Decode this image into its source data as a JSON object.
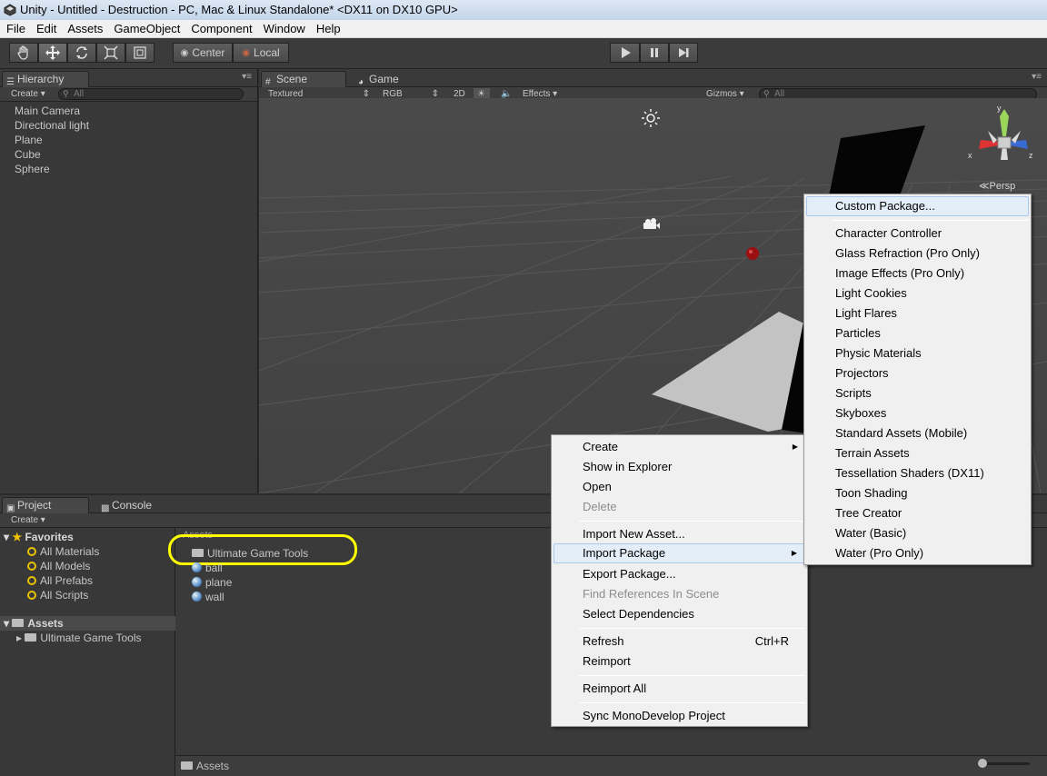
{
  "window": {
    "title": "Unity - Untitled - Destruction - PC, Mac & Linux Standalone* <DX11 on DX10 GPU>"
  },
  "menubar": [
    "File",
    "Edit",
    "Assets",
    "GameObject",
    "Component",
    "Window",
    "Help"
  ],
  "toolbar": {
    "pivot_label": "Center",
    "space_label": "Local"
  },
  "hierarchy": {
    "tab": "Hierarchy",
    "create": "Create",
    "search_placeholder": "All",
    "items": [
      "Main Camera",
      "Directional light",
      "Plane",
      "Cube",
      "Sphere"
    ]
  },
  "scene": {
    "tab_scene": "Scene",
    "tab_game": "Game",
    "shading": "Textured",
    "render_mode": "RGB",
    "mode_2d": "2D",
    "effects": "Effects",
    "gizmos": "Gizmos",
    "search_placeholder": "All",
    "axis_x": "x",
    "axis_y": "y",
    "axis_z": "z",
    "projection": "Persp"
  },
  "project": {
    "tab_project": "Project",
    "tab_console": "Console",
    "create": "Create",
    "favorites_label": "Favorites",
    "favorites": [
      "All Materials",
      "All Models",
      "All Prefabs",
      "All Scripts"
    ],
    "assets_label": "Assets",
    "tree_children": [
      "Ultimate Game Tools"
    ],
    "breadcrumb": "Assets",
    "files": [
      {
        "name": "Ultimate Game Tools",
        "kind": "folder"
      },
      {
        "name": "ball",
        "kind": "asset"
      },
      {
        "name": "plane",
        "kind": "asset"
      },
      {
        "name": "wall",
        "kind": "asset"
      }
    ],
    "footer_path": "Assets",
    "highlight_color": "#ffff00"
  },
  "context_menu": {
    "items": [
      {
        "label": "Create",
        "submenu": true
      },
      {
        "label": "Show in Explorer"
      },
      {
        "label": "Open"
      },
      {
        "label": "Delete",
        "disabled": true
      },
      {
        "label": "Import New Asset..."
      },
      {
        "label": "Import Package",
        "submenu": true,
        "highlighted": true
      },
      {
        "label": "Export Package..."
      },
      {
        "label": "Find References In Scene",
        "disabled": true
      },
      {
        "label": "Select Dependencies"
      },
      {
        "label": "Refresh",
        "shortcut": "Ctrl+R"
      },
      {
        "label": "Reimport"
      },
      {
        "label": "Reimport All"
      },
      {
        "label": "Sync MonoDevelop Project"
      }
    ]
  },
  "import_submenu": {
    "items": [
      "Custom Package...",
      "Character Controller",
      "Glass Refraction (Pro Only)",
      "Image Effects (Pro Only)",
      "Light Cookies",
      "Light Flares",
      "Particles",
      "Physic Materials",
      "Projectors",
      "Scripts",
      "Skyboxes",
      "Standard Assets (Mobile)",
      "Terrain Assets",
      "Tessellation Shaders (DX11)",
      "Toon Shading",
      "Tree Creator",
      "Water (Basic)",
      "Water (Pro Only)"
    ]
  }
}
